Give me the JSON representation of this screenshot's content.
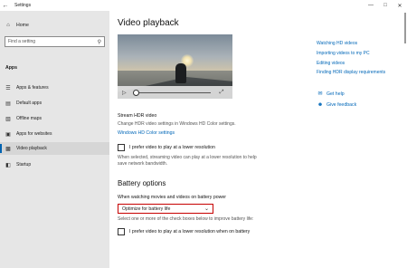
{
  "window": {
    "title": "Settings"
  },
  "titlebar": {
    "minimize_icon": "minimize-icon",
    "maximize_icon": "maximize-icon",
    "close_icon": "close-icon"
  },
  "sidebar": {
    "home": "Home",
    "search_placeholder": "Find a setting",
    "heading": "Apps",
    "items": [
      {
        "label": "Apps & features",
        "icon": "list-icon"
      },
      {
        "label": "Default apps",
        "icon": "default-apps-icon"
      },
      {
        "label": "Offline maps",
        "icon": "map-icon"
      },
      {
        "label": "Apps for websites",
        "icon": "website-icon"
      },
      {
        "label": "Video playback",
        "icon": "video-icon",
        "active": true
      },
      {
        "label": "Startup",
        "icon": "startup-icon"
      }
    ]
  },
  "main": {
    "title": "Video playback",
    "video_progress_fraction": 0.0,
    "stream_hdr": {
      "label": "Stream HDR video",
      "desc": "Change HDR video settings in Windows HD Color settings.",
      "link": "Windows HD Color settings"
    },
    "lower_res": {
      "label": "I prefer video to play at a lower resolution",
      "desc1": "When selected, streaming video can play at a lower resolution to help",
      "desc2": "save network bandwidth."
    },
    "battery": {
      "heading": "Battery options",
      "label": "When watching movies and videos on battery power",
      "dropdown_value": "Optimize for battery life",
      "desc": "Select one or more of the check boxes below to improve battery life:",
      "checkbox": "I prefer video to play at a lower resolution when on battery"
    }
  },
  "related": {
    "links": [
      "Watching HD videos",
      "Importing videos to my PC",
      "Editing videos",
      "Finding HDR display requirements"
    ],
    "help": "Get help",
    "feedback": "Give feedback"
  }
}
